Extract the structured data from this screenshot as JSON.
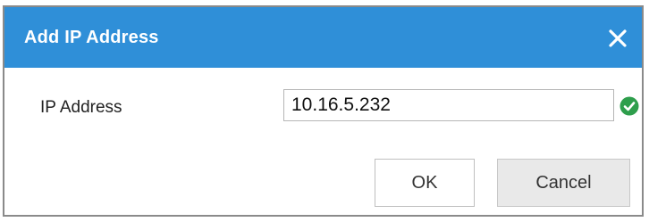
{
  "dialog": {
    "title": "Add IP Address",
    "close_icon": "close-icon",
    "colors": {
      "titlebar": "#2f8fd8",
      "valid": "#2e9e4c"
    }
  },
  "form": {
    "ip_label": "IP Address",
    "ip_value": "10.16.5.232",
    "valid_icon": "check-circle-icon"
  },
  "buttons": {
    "ok_label": "OK",
    "cancel_label": "Cancel"
  }
}
